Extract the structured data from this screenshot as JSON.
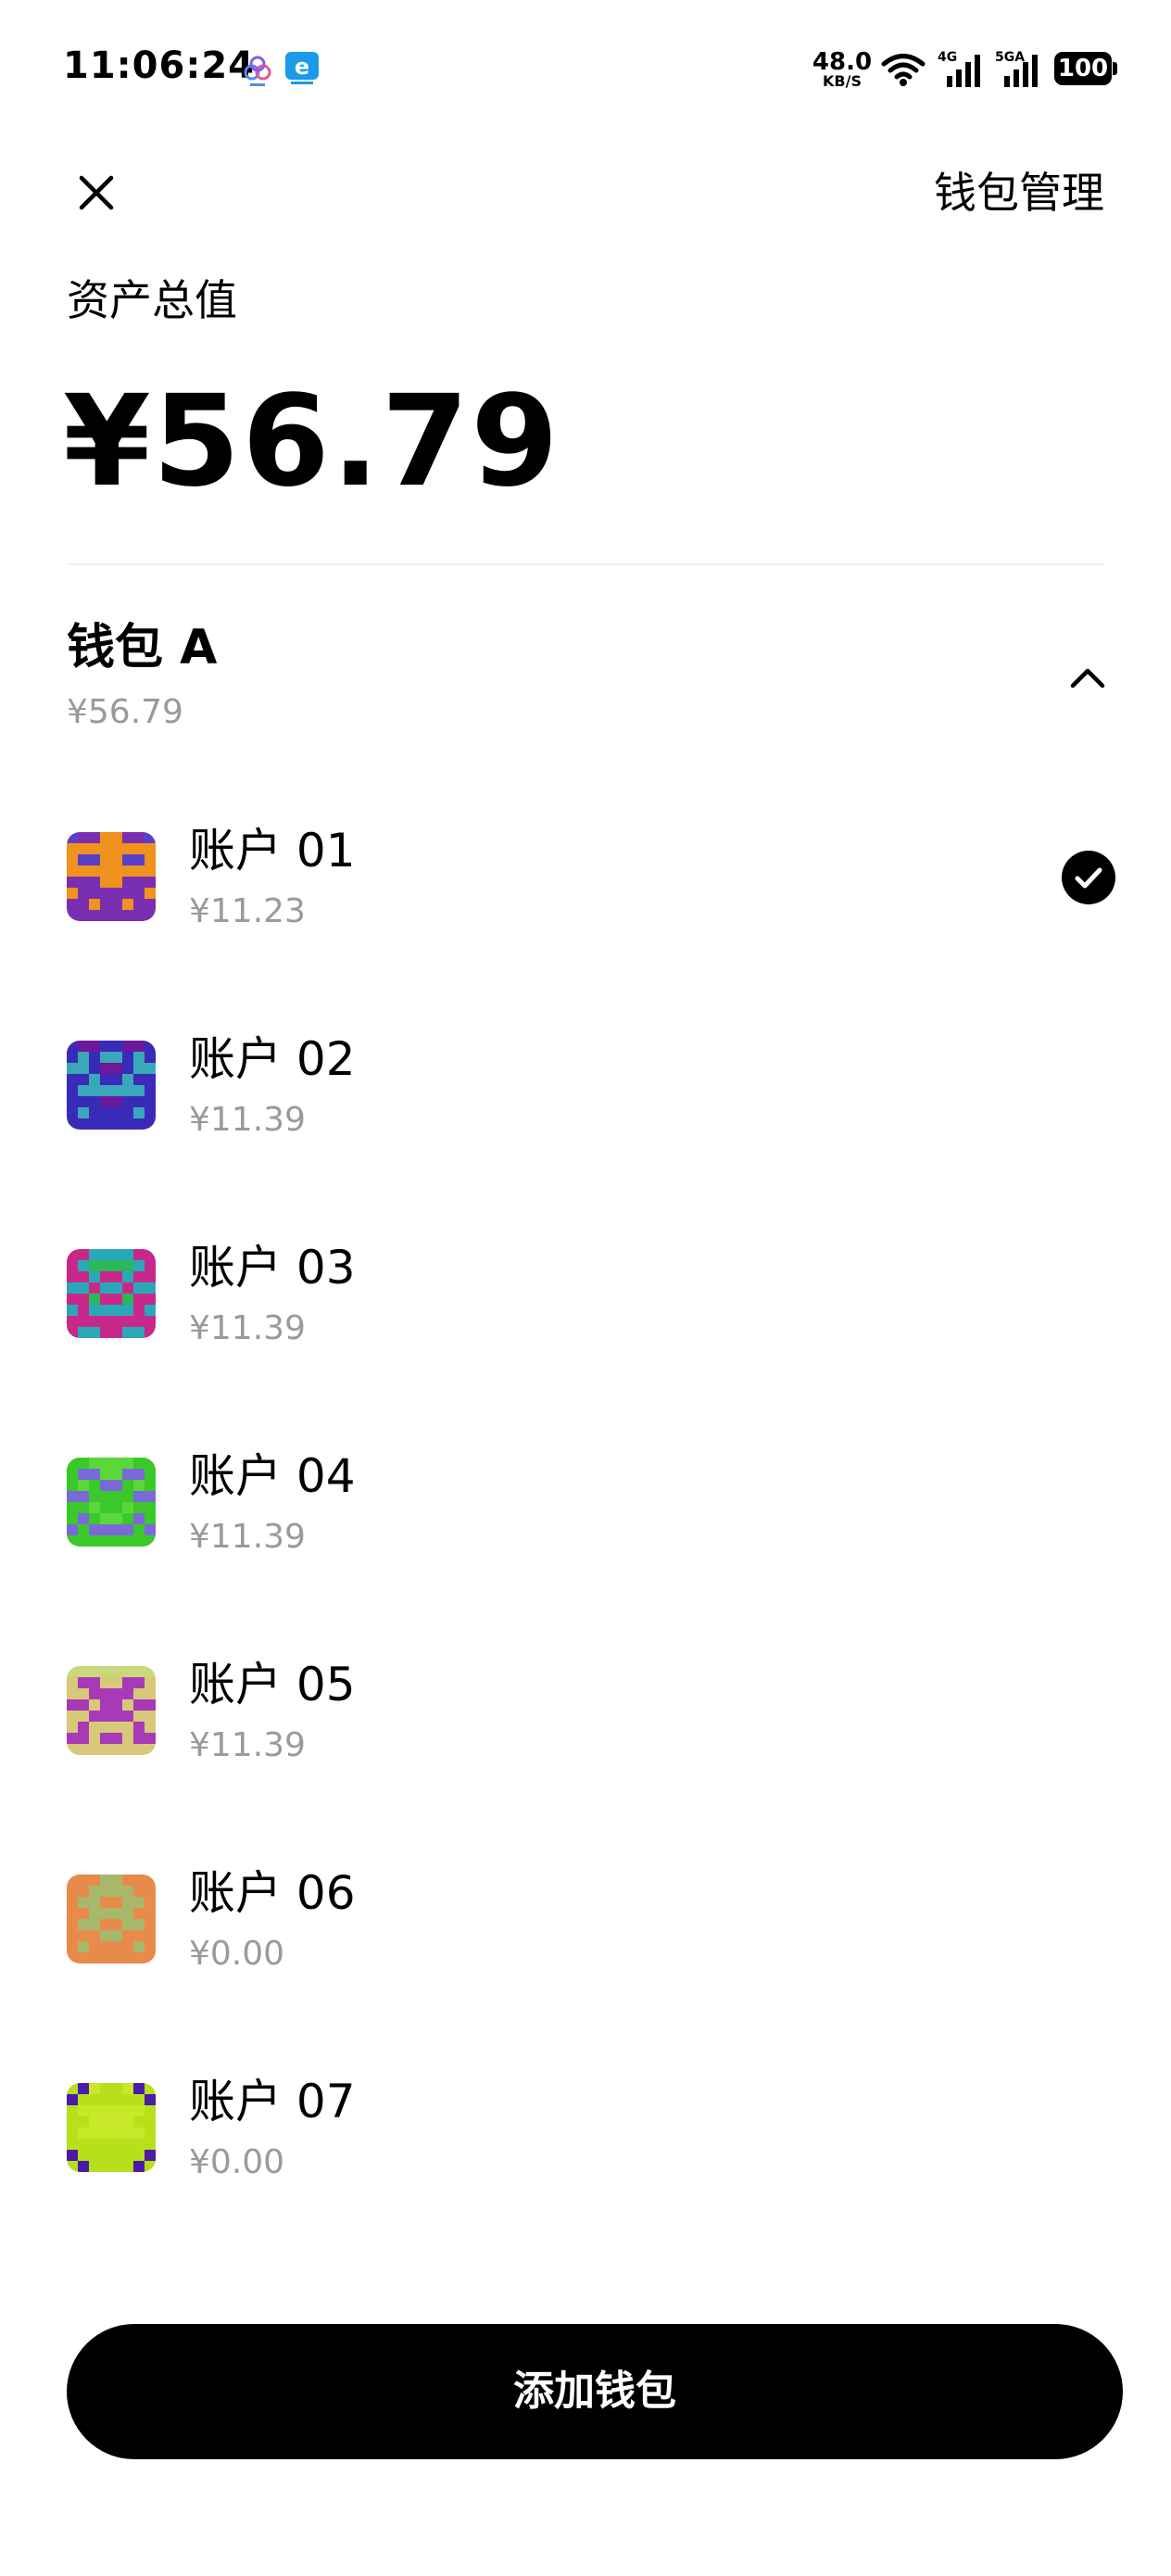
{
  "status_bar": {
    "time": "11:06:24",
    "net_speed_value": "48.0",
    "net_speed_unit": "KB/S",
    "signal1_label": "4G",
    "signal2_label": "5GA",
    "battery": "100"
  },
  "header": {
    "manage_label": "钱包管理"
  },
  "total": {
    "label": "资产总值",
    "value": "¥56.79"
  },
  "wallet": {
    "title": "钱包 A",
    "balance": "¥56.79"
  },
  "accounts": [
    {
      "name": "账户 01",
      "balance": "¥11.23",
      "selected": true,
      "colors": {
        "bg": "#7a2fb0",
        "fg": "#f0921e",
        "alt": "#5a3ec8"
      }
    },
    {
      "name": "账户 02",
      "balance": "¥11.39",
      "selected": false,
      "colors": {
        "bg": "#3a2ab8",
        "fg": "#3aa8b8",
        "alt": "#6a1a9a"
      }
    },
    {
      "name": "账户 03",
      "balance": "¥11.39",
      "selected": false,
      "colors": {
        "bg": "#c8288a",
        "fg": "#2aa8b8",
        "alt": "#2ab858"
      }
    },
    {
      "name": "账户 04",
      "balance": "¥11.39",
      "selected": false,
      "colors": {
        "bg": "#3ac82a",
        "fg": "#7a6ad8",
        "alt": "#5ad83a"
      }
    },
    {
      "name": "账户 05",
      "balance": "¥11.39",
      "selected": false,
      "colors": {
        "bg": "#d8c87a",
        "fg": "#a83ab8",
        "alt": "#c8d87a"
      }
    },
    {
      "name": "账户 06",
      "balance": "¥0.00",
      "selected": false,
      "colors": {
        "bg": "#e88a4a",
        "fg": "#a8b86a",
        "alt": "#e89a4a"
      }
    },
    {
      "name": "账户 07",
      "balance": "¥0.00",
      "selected": false,
      "colors": {
        "bg": "#b8e01a",
        "fg": "#4a1aa8",
        "alt": "#c8e82a"
      }
    }
  ],
  "footer": {
    "add_wallet_label": "添加钱包"
  },
  "icons": {
    "close": "close-icon",
    "chevron": "chevron-up-icon",
    "check": "check-circle-icon"
  }
}
